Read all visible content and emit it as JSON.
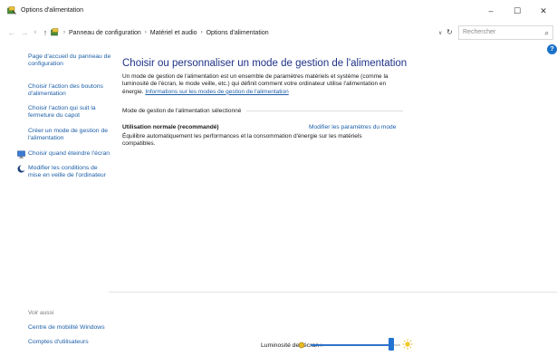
{
  "window": {
    "title": "Options d'alimentation",
    "controls": {
      "minimize": "–",
      "maximize": "☐",
      "close": "✕"
    }
  },
  "address": {
    "back": "←",
    "forward": "→",
    "recent": "∨",
    "up": "↑",
    "crumbs": [
      "Panneau de configuration",
      "Matériel et audio",
      "Options d'alimentation"
    ],
    "separator": "›",
    "dropdown": "∨",
    "refresh": "↻",
    "search_placeholder": "Rechercher",
    "search_icon": "⌕"
  },
  "help_badge": "?",
  "sidebar": {
    "items": [
      {
        "label": "Page d'accueil du panneau de configuration"
      },
      {
        "label": "Choisir l'action des boutons d'alimentation"
      },
      {
        "label": "Choisir l'action qui suit la fermeture du capot"
      },
      {
        "label": "Créer un mode de gestion de l'alimentation"
      },
      {
        "label": "Choisir quand éteindre l'écran",
        "icon": "monitor-icon"
      },
      {
        "label": "Modifier les conditions de mise en veille de l'ordinateur",
        "icon": "moon-icon"
      }
    ],
    "see_also_title": "Voir aussi",
    "see_also": [
      {
        "label": "Centre de mobilité Windows"
      },
      {
        "label": "Comptes d'utilisateurs"
      }
    ]
  },
  "main": {
    "title": "Choisir ou personnaliser un mode de gestion de l'alimentation",
    "description": "Un mode de gestion de l'alimentation est un ensemble de paramètres matériels et système (comme la luminosité de l'écran, le mode veille, etc.) qui définit comment votre ordinateur utilise l'alimentation en énergie.",
    "description_link": "Informations sur les modes de gestion de l'alimentation",
    "section_title": "Mode de gestion de l'alimentation sélectionné",
    "plan_name": "Utilisation normale (recommandé)",
    "plan_edit_link": "Modifier les paramètres du mode",
    "plan_description": "Équilibre automatiquement les performances et la consommation d'énergie sur les matériels compatibles."
  },
  "brightness": {
    "label": "Luminosité de l'écran :",
    "level_percent": 90
  },
  "colors": {
    "title_blue": "#1e3287",
    "link_blue": "#1c5ea8",
    "slider_blue": "#2273d2"
  }
}
